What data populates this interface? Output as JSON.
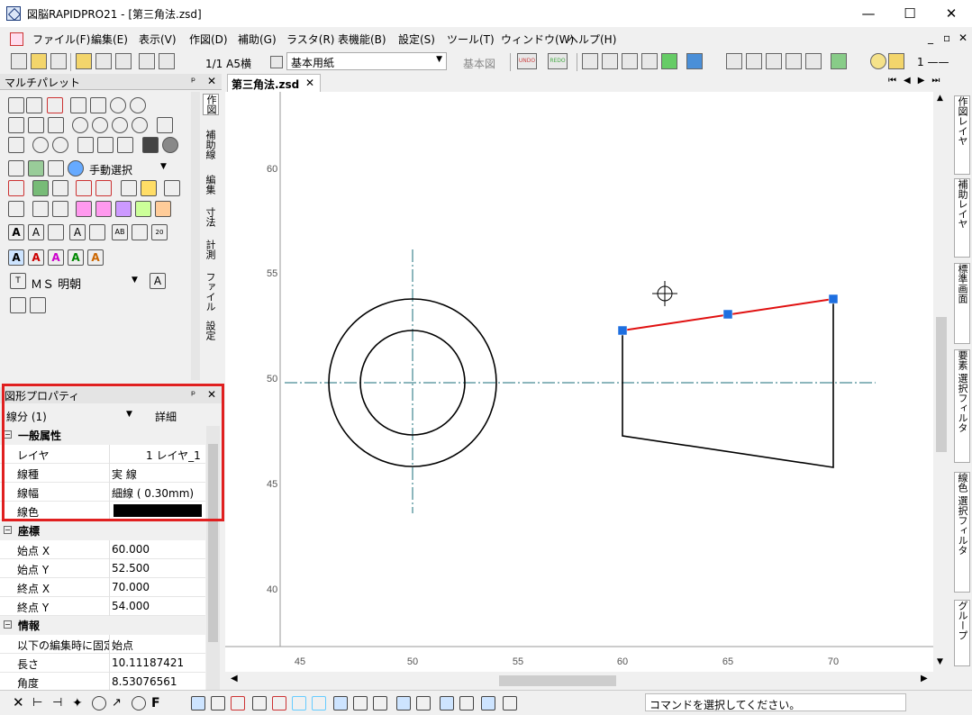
{
  "window": {
    "title": "図脳RAPIDPRO21 - [第三角法.zsd]",
    "min": "—",
    "max": "☐",
    "close": "✕"
  },
  "menu": [
    "ファイル(F)",
    "編集(E)",
    "表示(V)",
    "作図(D)",
    "補助(G)",
    "ラスタ(R)",
    "表機能(B)",
    "設定(S)",
    "ツール(T)",
    "ウィンドウ(W)",
    "ヘルプ(H)"
  ],
  "mdi_controls": [
    "_",
    "▫",
    "✕"
  ],
  "toolbar": {
    "page": "1/1 A5横",
    "paper": "基本用紙",
    "view": "基本図",
    "undo": "UNDO",
    "redo": "REDO",
    "line_width": "1 ——"
  },
  "multipalette": {
    "title": "マルチパレット",
    "pin": "ᵖ",
    "close": "✕",
    "select_mode": "手動選択",
    "font": "ＭＳ 明朝"
  },
  "palette_tabs": [
    "作図",
    "補助線",
    "編集",
    "寸法",
    "計測",
    "ファイル",
    "設定"
  ],
  "property": {
    "title": "図形プロパティ",
    "object": "線分 (1)",
    "detail_button": "詳細"
  },
  "sections": {
    "general": {
      "title": "一般属性",
      "rows": [
        {
          "k": "レイヤ",
          "v": "1 レイヤ_1"
        },
        {
          "k": "線種",
          "v": "実 線"
        },
        {
          "k": "線幅",
          "v": "細線 ( 0.30mm)"
        },
        {
          "k": "線色",
          "v": ""
        }
      ]
    },
    "coords": {
      "title": "座標",
      "rows": [
        {
          "k": "始点 X",
          "v": "60.000"
        },
        {
          "k": "始点 Y",
          "v": "52.500"
        },
        {
          "k": "終点 X",
          "v": "70.000"
        },
        {
          "k": "終点 Y",
          "v": "54.000"
        }
      ]
    },
    "info": {
      "title": "情報",
      "rows": [
        {
          "k": "以下の編集時に固定",
          "v": "始点"
        },
        {
          "k": "長さ",
          "v": "10.11187421"
        },
        {
          "k": "角度",
          "v": "8.53076561"
        }
      ]
    }
  },
  "doc_tab": "第三角法.zsd",
  "ruler": {
    "x": [
      "45",
      "50",
      "55",
      "60",
      "65",
      "70"
    ],
    "y": [
      "60",
      "55",
      "50",
      "45",
      "40"
    ]
  },
  "right_tabs": [
    "作図レイヤ",
    "補助レイヤ",
    "標準画面",
    "要素 選択フィルタ",
    "線色 選択フィルタ",
    "グループ"
  ],
  "status": "コマンドを選択してください。",
  "colors": {
    "highlight": "#e02020",
    "selected_line": "#e01010",
    "handle": "#1e6fe0",
    "centerline": "#1a6e78"
  }
}
